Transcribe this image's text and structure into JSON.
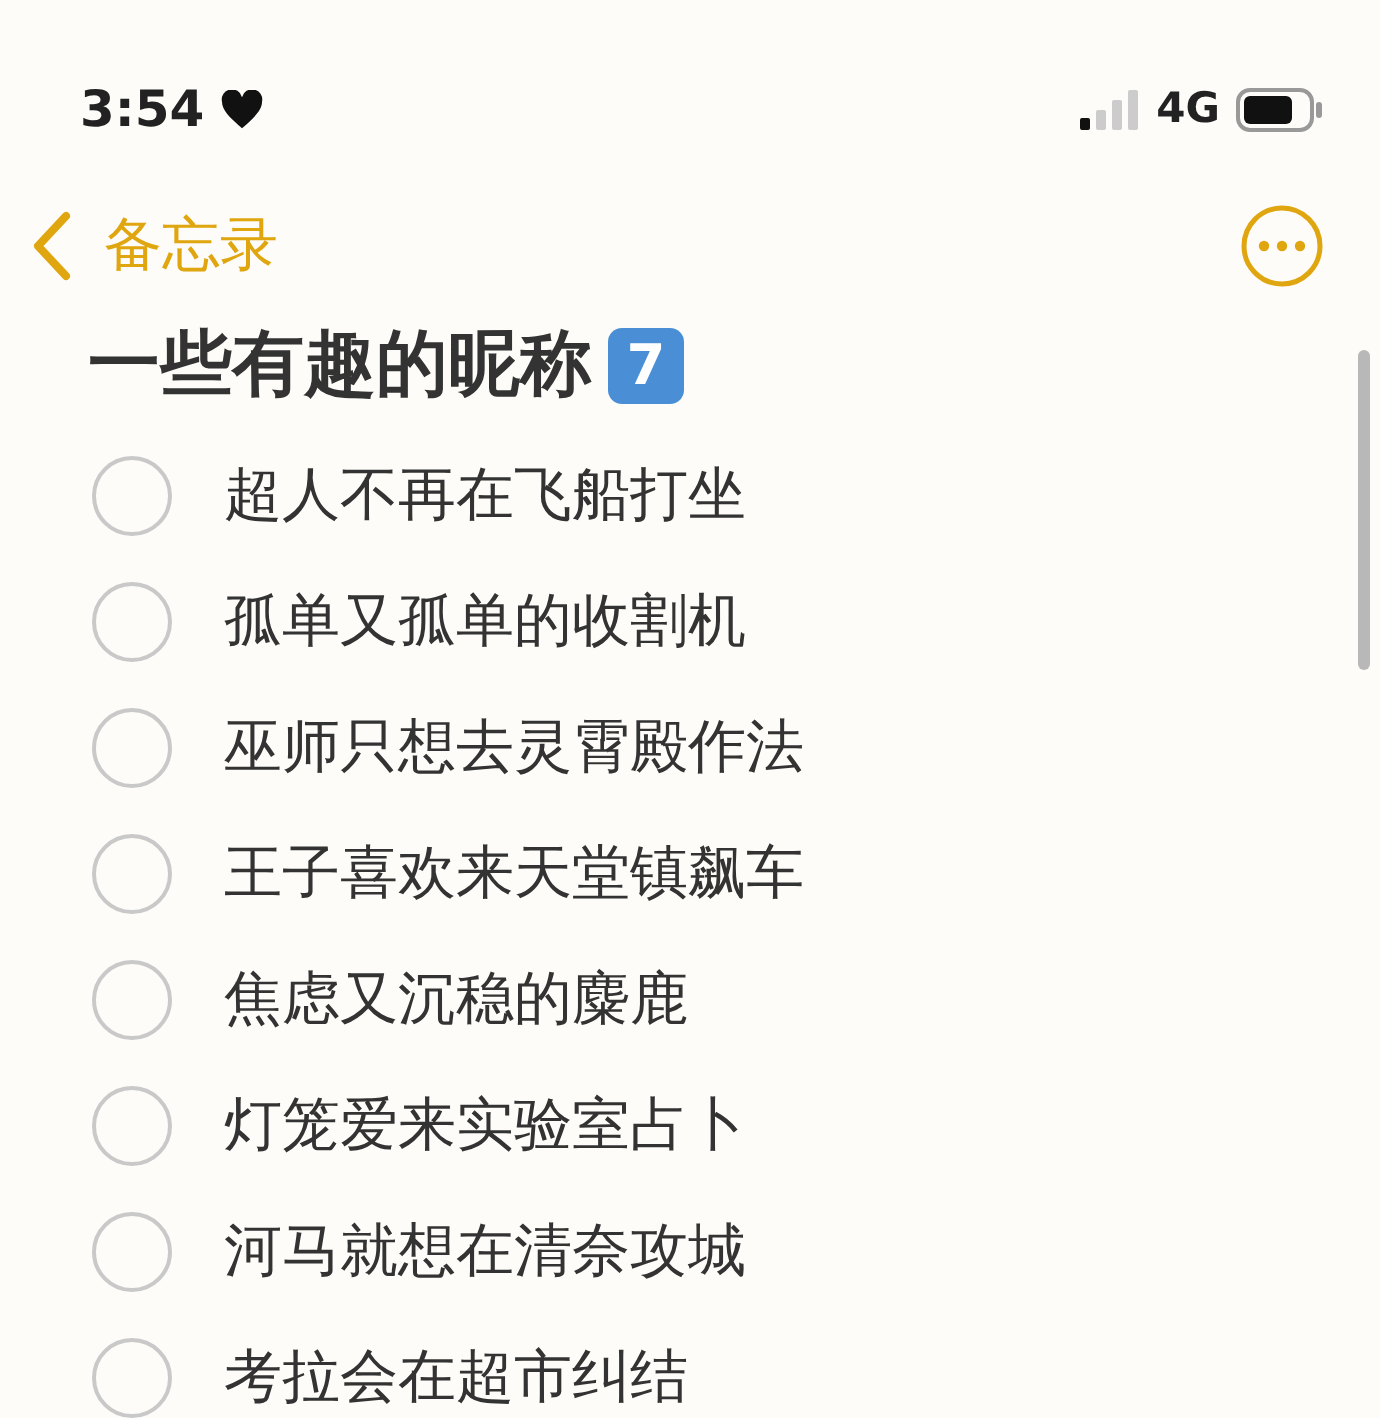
{
  "status_bar": {
    "time": "3:54",
    "network": "4G"
  },
  "nav": {
    "back_label": "备忘录"
  },
  "note": {
    "title": "一些有趣的昵称",
    "badge": "7",
    "items": [
      {
        "text": "超人不再在飞船打坐",
        "checked": false
      },
      {
        "text": "孤单又孤单的收割机",
        "checked": false
      },
      {
        "text": "巫师只想去灵霄殿作法",
        "checked": false
      },
      {
        "text": "王子喜欢来天堂镇飙车",
        "checked": false
      },
      {
        "text": "焦虑又沉稳的麋鹿",
        "checked": false
      },
      {
        "text": "灯笼爱来实验室占卜",
        "checked": false
      },
      {
        "text": "河马就想在清奈攻城",
        "checked": false
      },
      {
        "text": "考拉会在超市纠结",
        "checked": false
      }
    ]
  }
}
